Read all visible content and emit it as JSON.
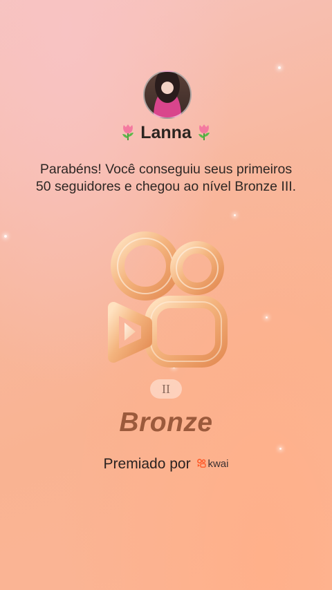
{
  "profile": {
    "name": "Lanna",
    "decoration_icon": "tulip-icon"
  },
  "message": "Parabéns! Você conseguiu seus primeiros 50 seguidores e chegou ao nível Bronze III.",
  "badge": {
    "level_roman": "II",
    "tier_name": "Bronze"
  },
  "footer": {
    "awarded_by": "Premiado por",
    "brand": "kwai",
    "brand_icon": "kwai-logo-icon"
  },
  "colors": {
    "tier_text": "#9b5a3c",
    "badge_gold": "#f2b27a",
    "background_top": "#f6c4bf",
    "background_bottom": "#fbb596"
  }
}
